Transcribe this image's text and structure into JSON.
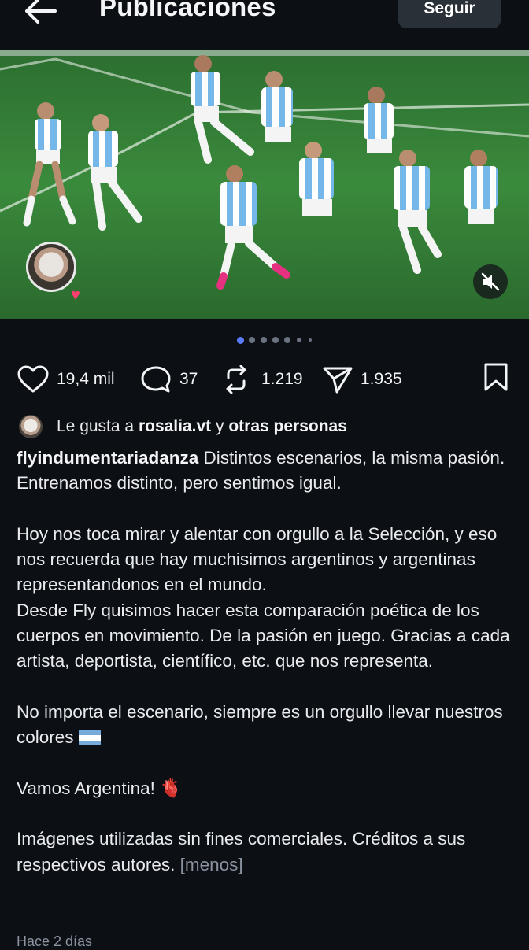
{
  "header": {
    "title": "Publicaciones",
    "follow_label": "Seguir",
    "back_icon": "arrow-left-icon"
  },
  "media": {
    "image_alt": "Jugadores de la Selección Argentina celebrando en el césped",
    "carousel_count": 7,
    "carousel_active": 0,
    "mute_icon": "speaker-muted-icon"
  },
  "actions": {
    "likes": "19,4 mil",
    "comments": "37",
    "reposts": "1.219",
    "shares": "1.935"
  },
  "liked_by": {
    "prefix": "Le gusta a",
    "user": "rosalia.vt",
    "connector": "y",
    "others": "otras personas"
  },
  "caption": {
    "username": "flyindumentariadanza",
    "line1_rest": " Distintos escenarios, la misma pasión.",
    "line2": "Entrenamos distinto, pero sentimos igual.",
    "para2": "Hoy nos toca mirar y alentar con orgullo a la Selección, y eso nos recuerda que hay muchisimos argentinos y argentinas representandonos en el mundo.",
    "para3": "Desde Fly quisimos hacer esta comparación poética de los cuerpos en movimiento. De la pasión en juego. Gracias a cada artista, deportista, científico, etc. que nos representa.",
    "para4": "No importa el escenario, siempre es un orgullo llevar nuestros colores",
    "para5": "Vamos Argentina!",
    "para6": "Imágenes utilizadas sin fines comerciales. Créditos a sus respectivos autores.",
    "less": "[menos]",
    "heart_emoji": "🫀"
  },
  "timestamp": "Hace 2 días",
  "colors": {
    "background": "#0c0f14",
    "follow_bg": "#2a3038",
    "active_dot": "#5b7cfa",
    "muted_text": "#8b93a0"
  }
}
